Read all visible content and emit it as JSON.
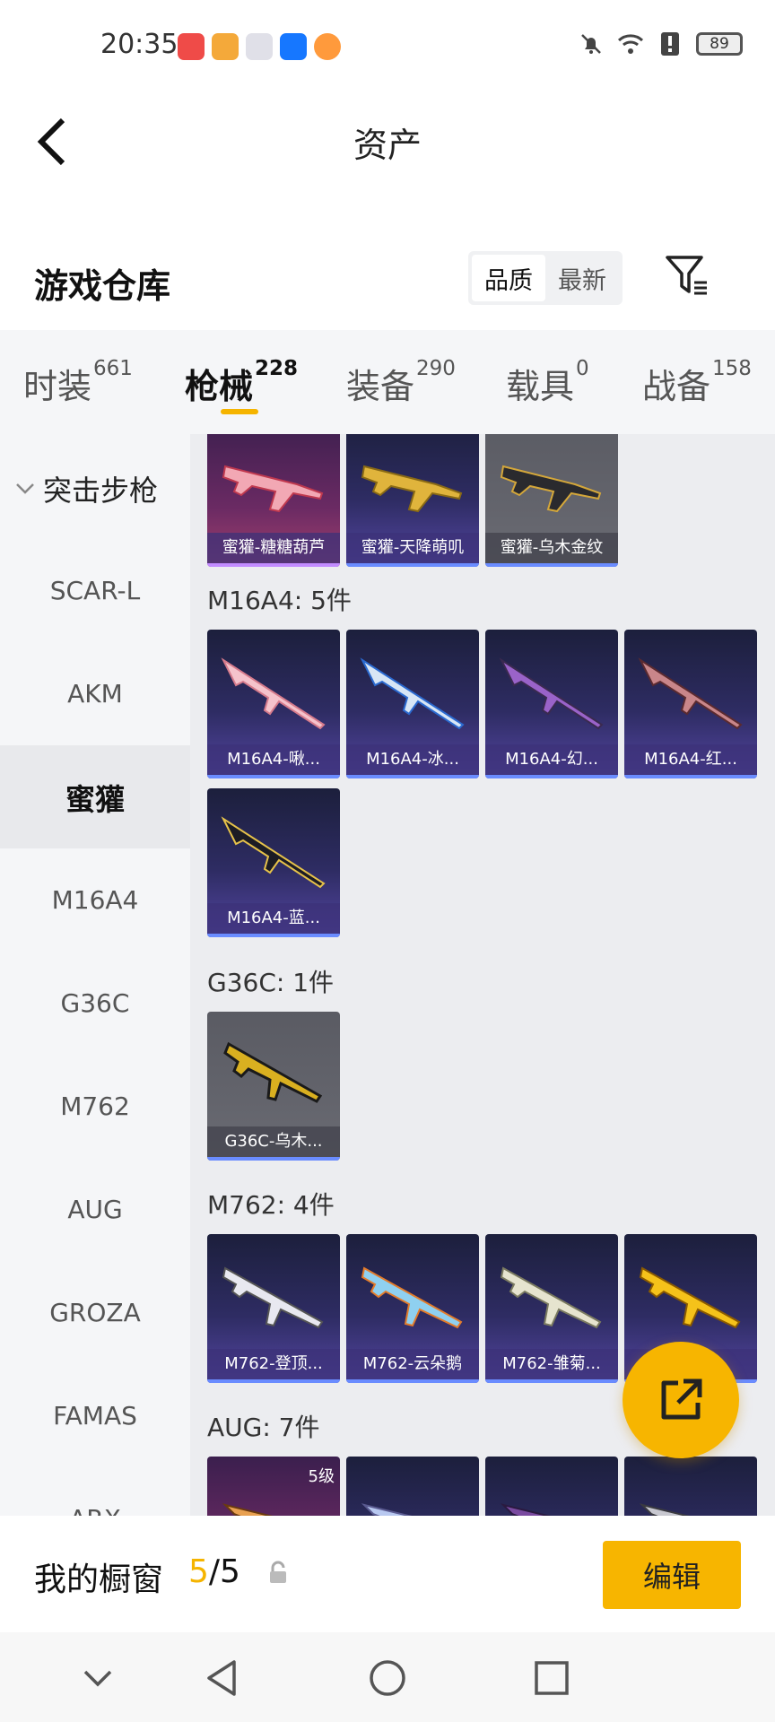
{
  "status_bar": {
    "time": "20:35",
    "battery": "89",
    "app_icon_colors": [
      "#ef4b48",
      "#f4a93a",
      "#e8e8ee",
      "#1677ff",
      "#ff9a3c"
    ]
  },
  "header": {
    "title": "资产",
    "back_icon": "chevron-left-icon"
  },
  "section": {
    "title": "游戏仓库",
    "sort_options": [
      "品质",
      "最新"
    ],
    "active_sort": "品质",
    "filter_icon": "filter-icon"
  },
  "tabs": [
    {
      "label": "时装",
      "count": "661"
    },
    {
      "label": "枪械",
      "count": "228"
    },
    {
      "label": "装备",
      "count": "290"
    },
    {
      "label": "载具",
      "count": "0"
    },
    {
      "label": "战备",
      "count": "158"
    }
  ],
  "active_tab": "枪械",
  "sidebar": {
    "category": "突击步枪",
    "items": [
      "SCAR-L",
      "AKM",
      "蜜獾",
      "M16A4",
      "G36C",
      "M762",
      "AUG",
      "GROZA",
      "FAMAS",
      "ARX"
    ],
    "active": "蜜獾"
  },
  "groups": [
    {
      "title": "",
      "items": [
        "蜜獾-糖糖葫芦",
        "蜜獾-天降萌叽",
        "蜜獾-乌木金纹"
      ]
    },
    {
      "title": "M16A4: 5件",
      "items": [
        "M16A4-啾...",
        "M16A4-冰...",
        "M16A4-幻...",
        "M16A4-红...",
        "M16A4-蓝..."
      ]
    },
    {
      "title": "G36C: 1件",
      "items": [
        "G36C-乌木..."
      ]
    },
    {
      "title": "M762: 4件",
      "items": [
        "M762-登顶...",
        "M762-云朵鹅",
        "M762-雏菊...",
        "..."
      ]
    },
    {
      "title": "AUG: 7件",
      "items": [
        "",
        "",
        "",
        ""
      ],
      "level_tag": "5级"
    }
  ],
  "fab": {
    "icon": "share-external-icon"
  },
  "bottom": {
    "window_label": "我的橱窗",
    "current": "5",
    "separator": "/",
    "total": "5",
    "edit_label": "编辑"
  },
  "accent_color": "#f7b500"
}
